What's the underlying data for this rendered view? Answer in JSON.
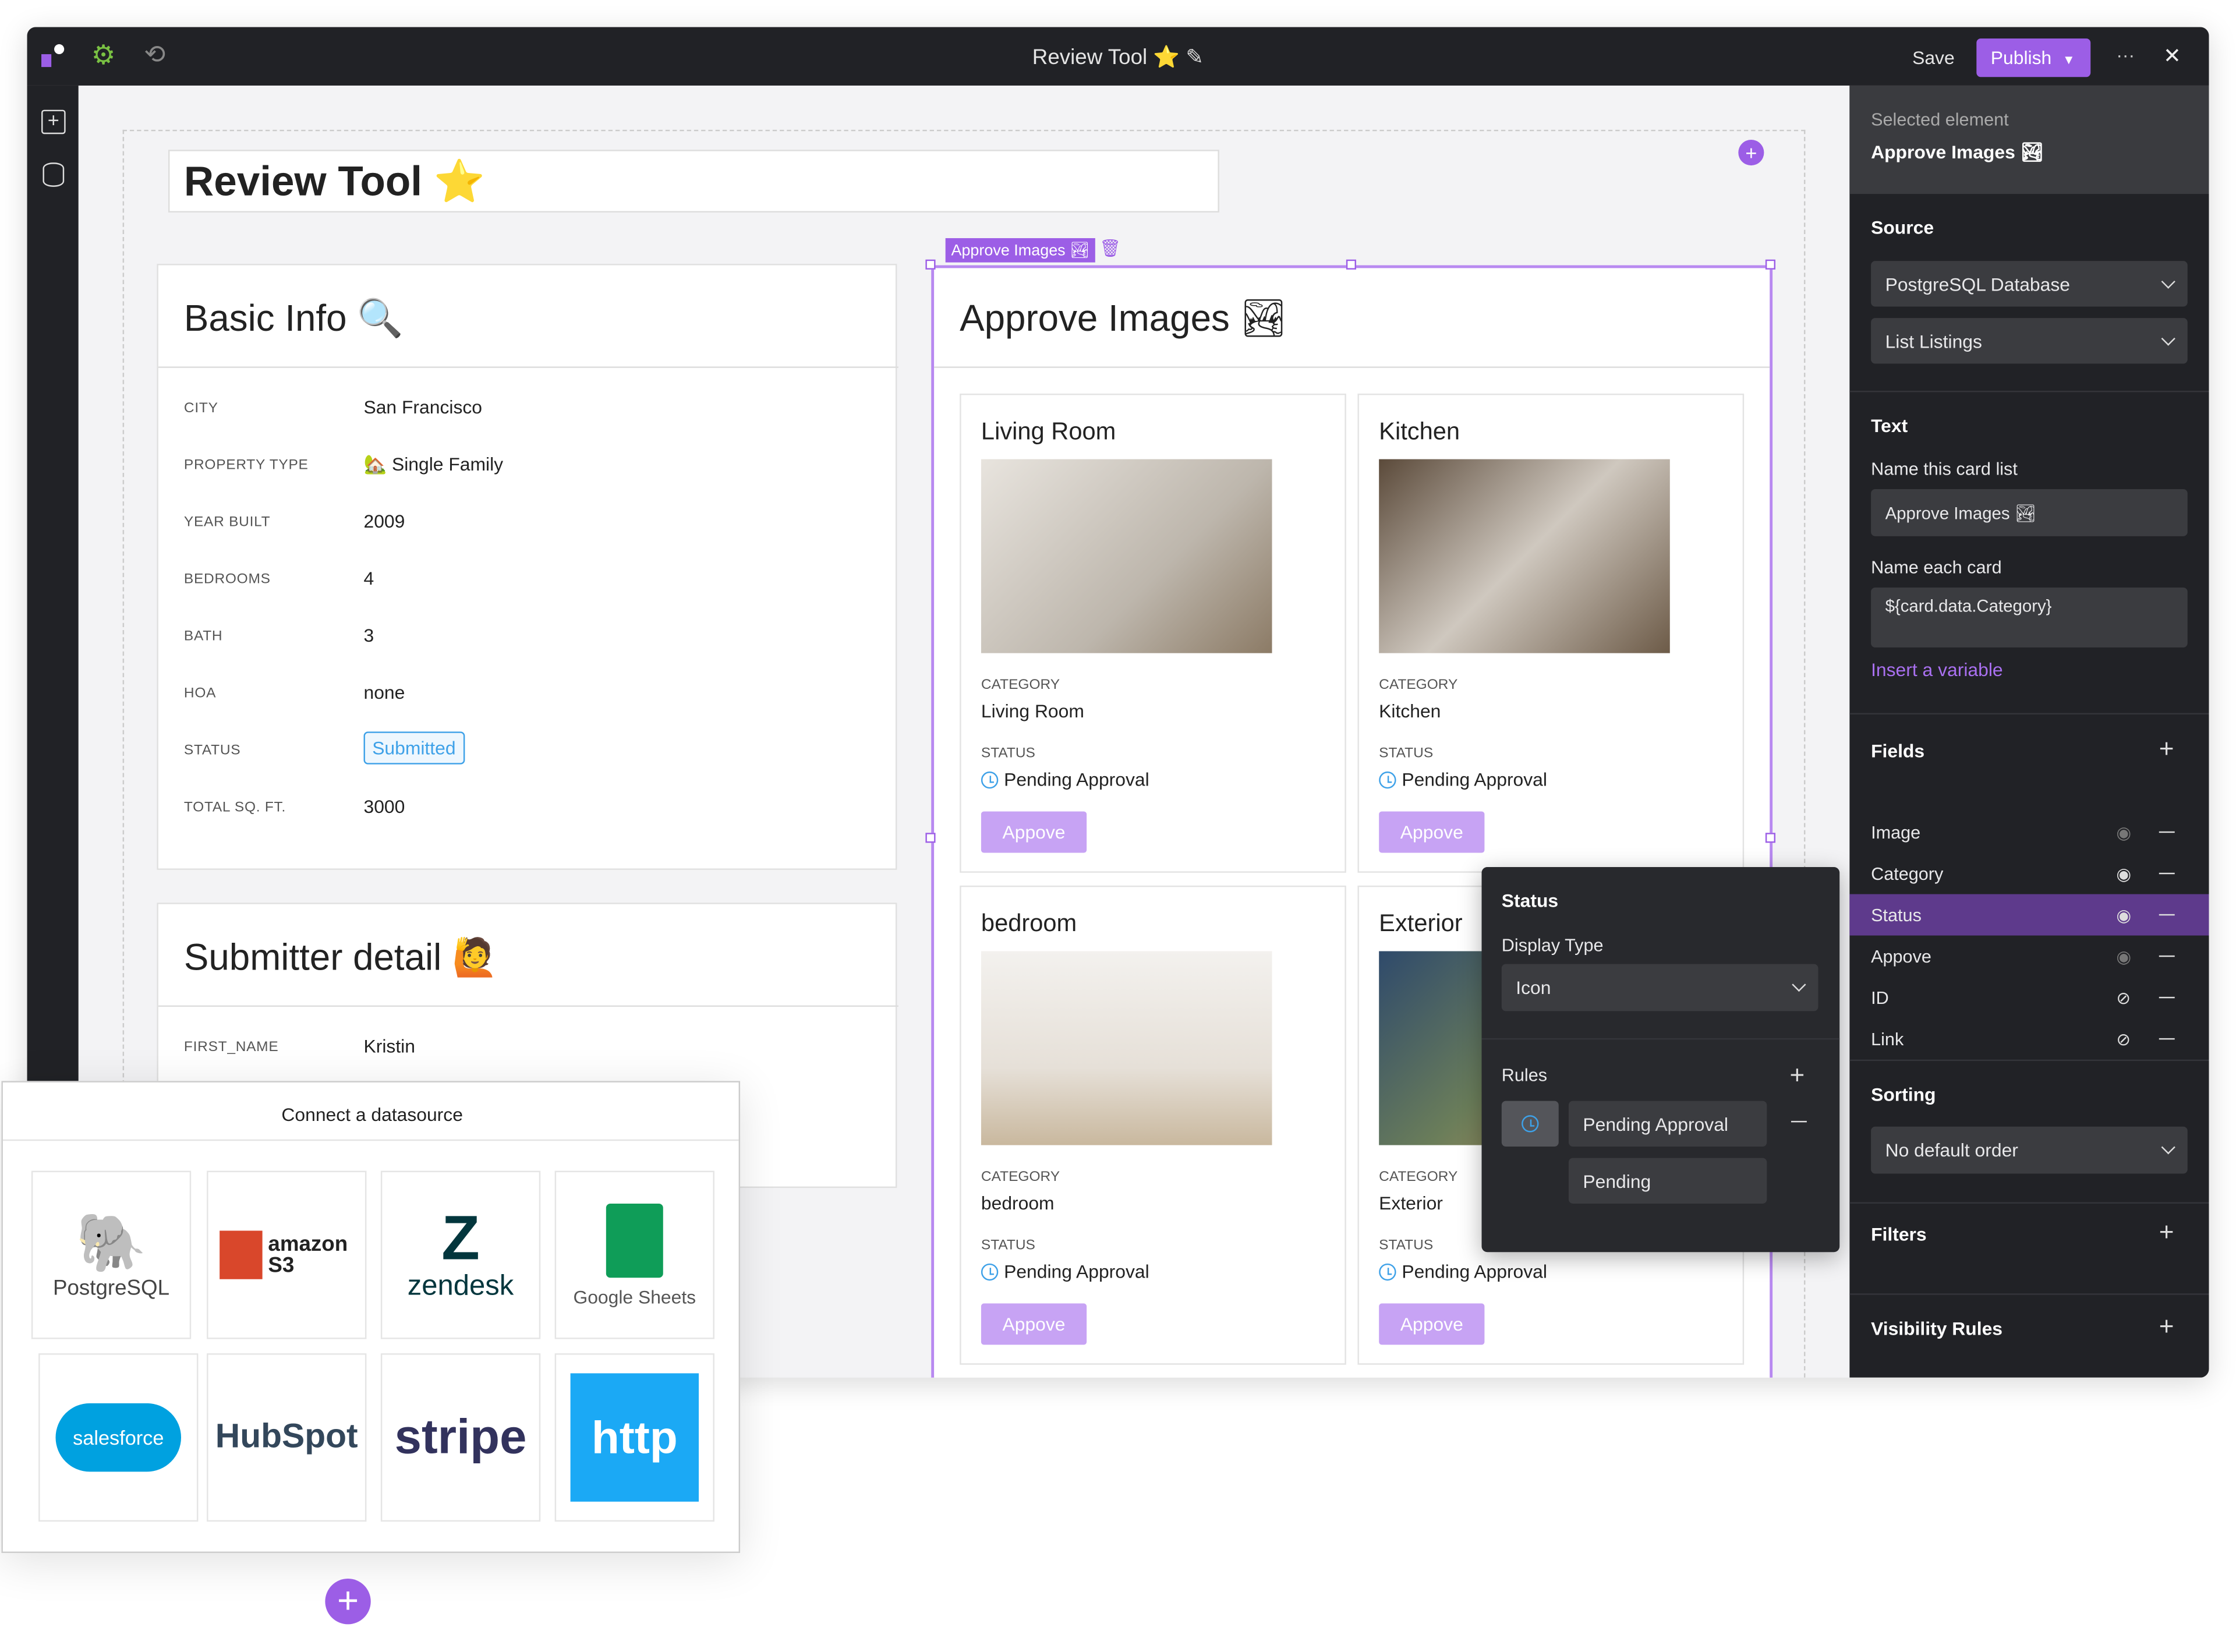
{
  "titlebar": {
    "title": "Review Tool ⭐",
    "save_label": "Save",
    "publish_label": "Publish",
    "more_label": "···",
    "close_label": "✕"
  },
  "colors": {
    "accent": "#9c5ee6",
    "dark": "#212226",
    "status_blue": "#3ea1e8",
    "approve_button": "#c7a3f4"
  },
  "canvas": {
    "page_title": "Review Tool ⭐",
    "basic_info": {
      "title": "Basic Info 🔍",
      "rows": [
        {
          "label": "CITY",
          "value": "San Francisco"
        },
        {
          "label": "PROPERTY TYPE",
          "value": "🏡 Single Family"
        },
        {
          "label": "YEAR BUILT",
          "value": "2009"
        },
        {
          "label": "BEDROOMS",
          "value": "4"
        },
        {
          "label": "BATH",
          "value": "3"
        },
        {
          "label": "HOA",
          "value": "none"
        },
        {
          "label": "STATUS",
          "value": "Submitted"
        },
        {
          "label": "TOTAL SQ. FT.",
          "value": "3000"
        }
      ]
    },
    "submitter": {
      "title": "Submitter detail 🙋",
      "rows": [
        {
          "label": "FIRST_NAME",
          "value": "Kristin"
        }
      ]
    },
    "approve": {
      "tag": "Approve Images 🏞",
      "title": "Approve Images 🏞",
      "cards": [
        {
          "title": "Living Room",
          "category_label": "CATEGORY",
          "category": "Living Room",
          "status_label": "STATUS",
          "status": "Pending Approval",
          "button": "Appove"
        },
        {
          "title": "Kitchen",
          "category_label": "CATEGORY",
          "category": "Kitchen",
          "status_label": "STATUS",
          "status": "Pending Approval",
          "button": "Appove"
        },
        {
          "title": "bedroom",
          "category_label": "CATEGORY",
          "category": "bedroom",
          "status_label": "STATUS",
          "status": "Pending Approval",
          "button": "Appove"
        },
        {
          "title": "Exterior",
          "category_label": "CATEGORY",
          "category": "Exterior",
          "status_label": "STATUS",
          "status": "Pending Approval",
          "button": "Appove"
        }
      ]
    }
  },
  "status_popover": {
    "title": "Status",
    "display_type_label": "Display Type",
    "display_type": "Icon",
    "rules_label": "Rules",
    "rule_value": "Pending Approval",
    "rule_display": "Pending"
  },
  "datasource": {
    "title": "Connect a datasource",
    "sources": [
      "PostgreSQL",
      "amazon S3",
      "zendesk",
      "Google Sheets",
      "salesforce",
      "HubSpot",
      "stripe",
      "http"
    ]
  },
  "panel": {
    "selected_label": "Selected element",
    "selected_name": "Approve Images 🏞",
    "source_heading": "Source",
    "source_db": "PostgreSQL Database",
    "source_query": "List Listings",
    "text_heading": "Text",
    "name_list_label": "Name this card list",
    "name_list_value": "Approve Images 🏞",
    "name_card_label": "Name each card",
    "name_card_value": "${card.data.Category}",
    "insert_variable": "Insert a variable",
    "fields_heading": "Fields",
    "fields": [
      {
        "name": "Image",
        "visible": true,
        "dim": true
      },
      {
        "name": "Category",
        "visible": true
      },
      {
        "name": "Status",
        "visible": true,
        "selected": true
      },
      {
        "name": "Appove",
        "visible": true,
        "dim": true
      },
      {
        "name": "ID",
        "visible": false
      },
      {
        "name": "Link",
        "visible": false
      }
    ],
    "sorting_heading": "Sorting",
    "sorting_value": "No default order",
    "filters_heading": "Filters",
    "visibility_heading": "Visibility Rules"
  }
}
